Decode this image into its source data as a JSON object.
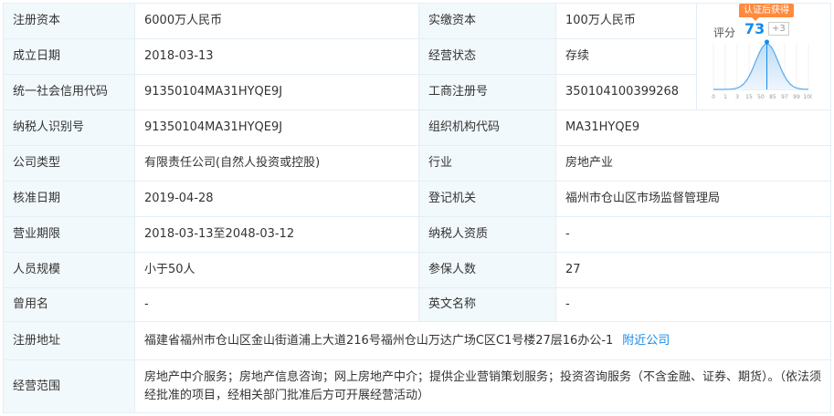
{
  "rows": [
    {
      "l1": "注册资本",
      "v1": "6000万人民币",
      "l2": "实缴资本",
      "v2": "100万人民币"
    },
    {
      "l1": "成立日期",
      "v1": "2018-03-13",
      "l2": "经营状态",
      "v2": "存续"
    },
    {
      "l1": "统一社会信用代码",
      "v1": "91350104MA31HYQE9J",
      "l2": "工商注册号",
      "v2": "350104100399268"
    },
    {
      "l1": "纳税人识别号",
      "v1": "91350104MA31HYQE9J",
      "l2": "组织机构代码",
      "v2": "MA31HYQE9"
    },
    {
      "l1": "公司类型",
      "v1": "有限责任公司(自然人投资或控股)",
      "l2": "行业",
      "v2": "房地产业"
    },
    {
      "l1": "核准日期",
      "v1": "2019-04-28",
      "l2": "登记机关",
      "v2": "福州市仓山区市场监督管理局"
    },
    {
      "l1": "营业期限",
      "v1": "2018-03-13至2048-03-12",
      "l2": "纳税人资质",
      "v2": "-"
    },
    {
      "l1": "人员规模",
      "v1": "小于50人",
      "l2": "参保人数",
      "v2": "27"
    },
    {
      "l1": "曾用名",
      "v1": "-",
      "l2": "英文名称",
      "v2": "-"
    }
  ],
  "address": {
    "label": "注册地址",
    "value": "福建省福州市仓山区金山街道浦上大道216号福州仓山万达广场C区C1号楼27层16办公-1",
    "link": "附近公司"
  },
  "scope": {
    "label": "经营范围",
    "value": "房地产中介服务；房地产信息咨询；网上房地产中介；提供企业营销策划服务；投资咨询服务（不含金融、证券、期货）。（依法须经批准的项目，经相关部门批准后方可开展经营活动）"
  },
  "score": {
    "badge": "认证后获得",
    "label": "评分",
    "value": 73,
    "delta": "+3",
    "ticks": [
      "0",
      "1",
      "3",
      "15",
      "50",
      "85",
      "97",
      "99",
      "100"
    ],
    "marker_tick": "50",
    "accent": "#128bed"
  }
}
